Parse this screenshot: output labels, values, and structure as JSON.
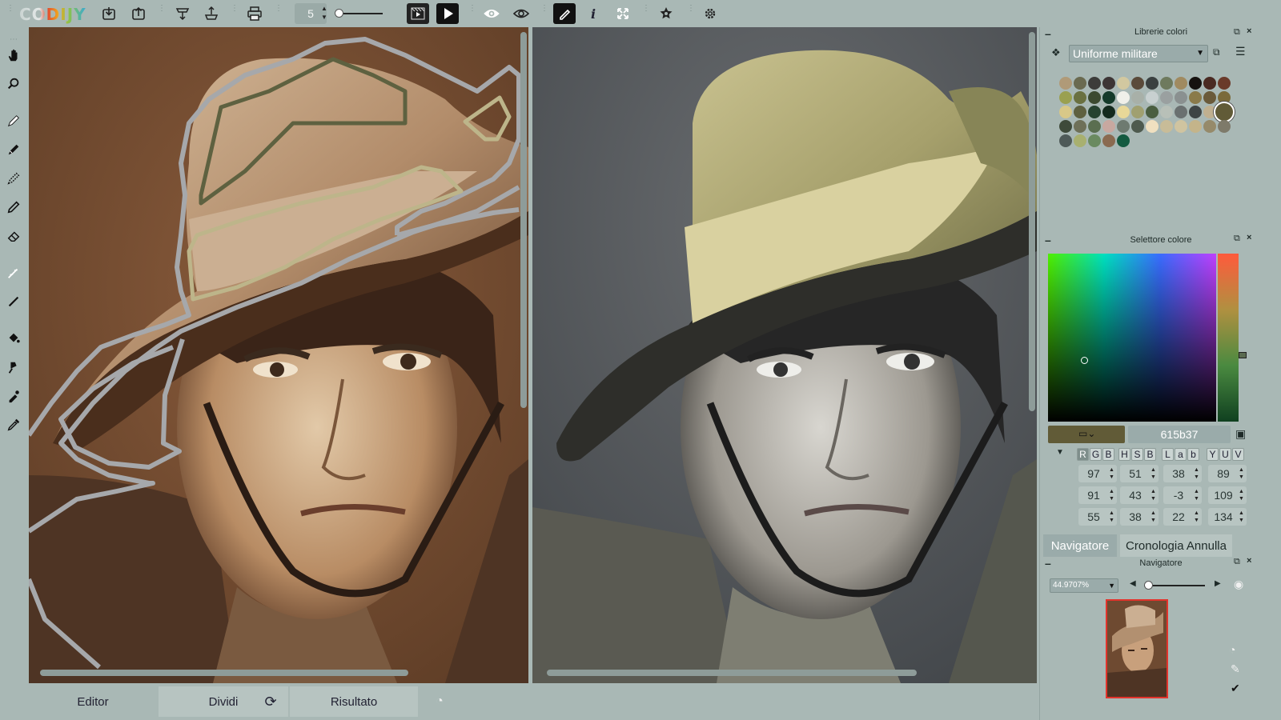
{
  "app": {
    "logo_text": "CODIJY",
    "brush_size": "5"
  },
  "bottom_tabs": {
    "editor": "Editor",
    "dividi": "Dividi",
    "risultato": "Risultato"
  },
  "color_libraries": {
    "title": "Librerie colori",
    "selected_library": "Uniforme militare",
    "swatches": [
      [
        "#b09a78",
        "#6a6a50",
        "#3c3c3a",
        "#3d3535",
        "#d2c8a0",
        "#5a4a3a",
        "#3a4040",
        "#6e7a5e",
        "#a08a60",
        "#161210",
        "#4a2a22",
        "#6a3a2a"
      ],
      [
        "#9aa050",
        "#6a7040",
        "#3c4a30",
        "#143a2a",
        "#f0f0ea",
        "#a8b0a8",
        "#c8d0d0",
        "#9aa0a0",
        "#8a9090",
        "#8a7a4a",
        "#6a5a3a",
        "#7a6a3a"
      ],
      [
        "#d8c888",
        "#5e6040",
        "#264230",
        "#142a1e",
        "#e8d898",
        "#a0a070",
        "#4a5e40",
        "#b8c0b8",
        "#6a7070",
        "#3e4444",
        "#c0b090",
        "#615b37"
      ],
      [
        "#3e4a3a",
        "#6e7058",
        "#5a6e50",
        "#c8a8a0",
        "#6e7a70",
        "#4e5a4e",
        "#f0e0c0",
        "#c8bc98",
        "#d0c4a0",
        "#c4b48a",
        "#968a6a",
        "#7e7a6a"
      ],
      [
        "#4e5a58",
        "#a8b070",
        "#6a8a60",
        "#8a6a50",
        "#145a40"
      ]
    ]
  },
  "color_picker": {
    "title": "Selettore colore",
    "hex": "615b37",
    "current_color": "#615b37",
    "model_buttons": [
      "R",
      "G",
      "B",
      "H",
      "S",
      "B",
      "L",
      "a",
      "b",
      "Y",
      "U",
      "V"
    ],
    "rows": [
      [
        "97",
        "51",
        "38",
        "89"
      ],
      [
        "91",
        "43",
        "-3",
        "109"
      ],
      [
        "55",
        "38",
        "22",
        "134"
      ]
    ]
  },
  "navigator": {
    "tab_navigatore": "Navigatore",
    "tab_cronologia": "Cronologia Annulla",
    "title": "Navigatore",
    "zoom": "44.9707%"
  },
  "colors": {
    "accent": "#e2332c",
    "panel_bg": "#a9b8b5",
    "stroke_gray": "#a6a8ab",
    "stroke_olive": "#5e6140",
    "stroke_khaki": "#bdb58a"
  }
}
